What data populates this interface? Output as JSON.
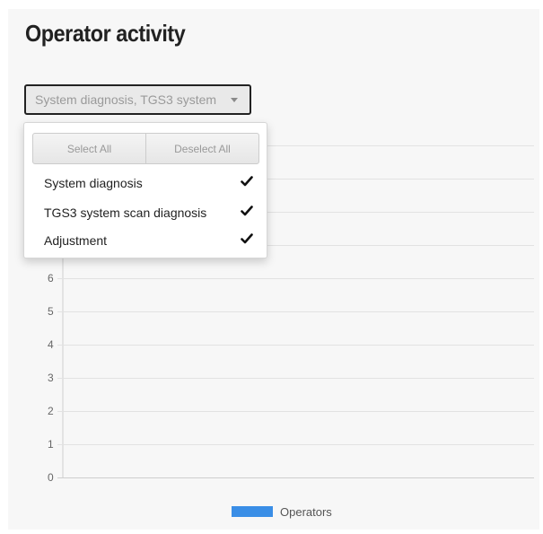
{
  "page": {
    "title": "Operator activity"
  },
  "filter": {
    "button_label": "System diagnosis, TGS3 system",
    "select_all_label": "Select All",
    "deselect_all_label": "Deselect All",
    "options": [
      {
        "label": "System diagnosis",
        "checked": true
      },
      {
        "label": "TGS3 system scan diagnosis",
        "checked": true
      },
      {
        "label": "Adjustment",
        "checked": true
      }
    ]
  },
  "chart_data": {
    "type": "bar",
    "title": "",
    "xlabel": "",
    "ylabel": "",
    "ylim": [
      0,
      10
    ],
    "yticks_visible": [
      0,
      1,
      2,
      3,
      4,
      5,
      6
    ],
    "grid": true,
    "categories": [],
    "series": [
      {
        "name": "Operators",
        "values": [],
        "color": "#3a8ee6"
      }
    ],
    "legend_position": "bottom"
  },
  "colors": {
    "series": "#3a8ee6",
    "grid": "#e2e2e2",
    "axis": "#cfcfcf",
    "check": "#111111"
  }
}
